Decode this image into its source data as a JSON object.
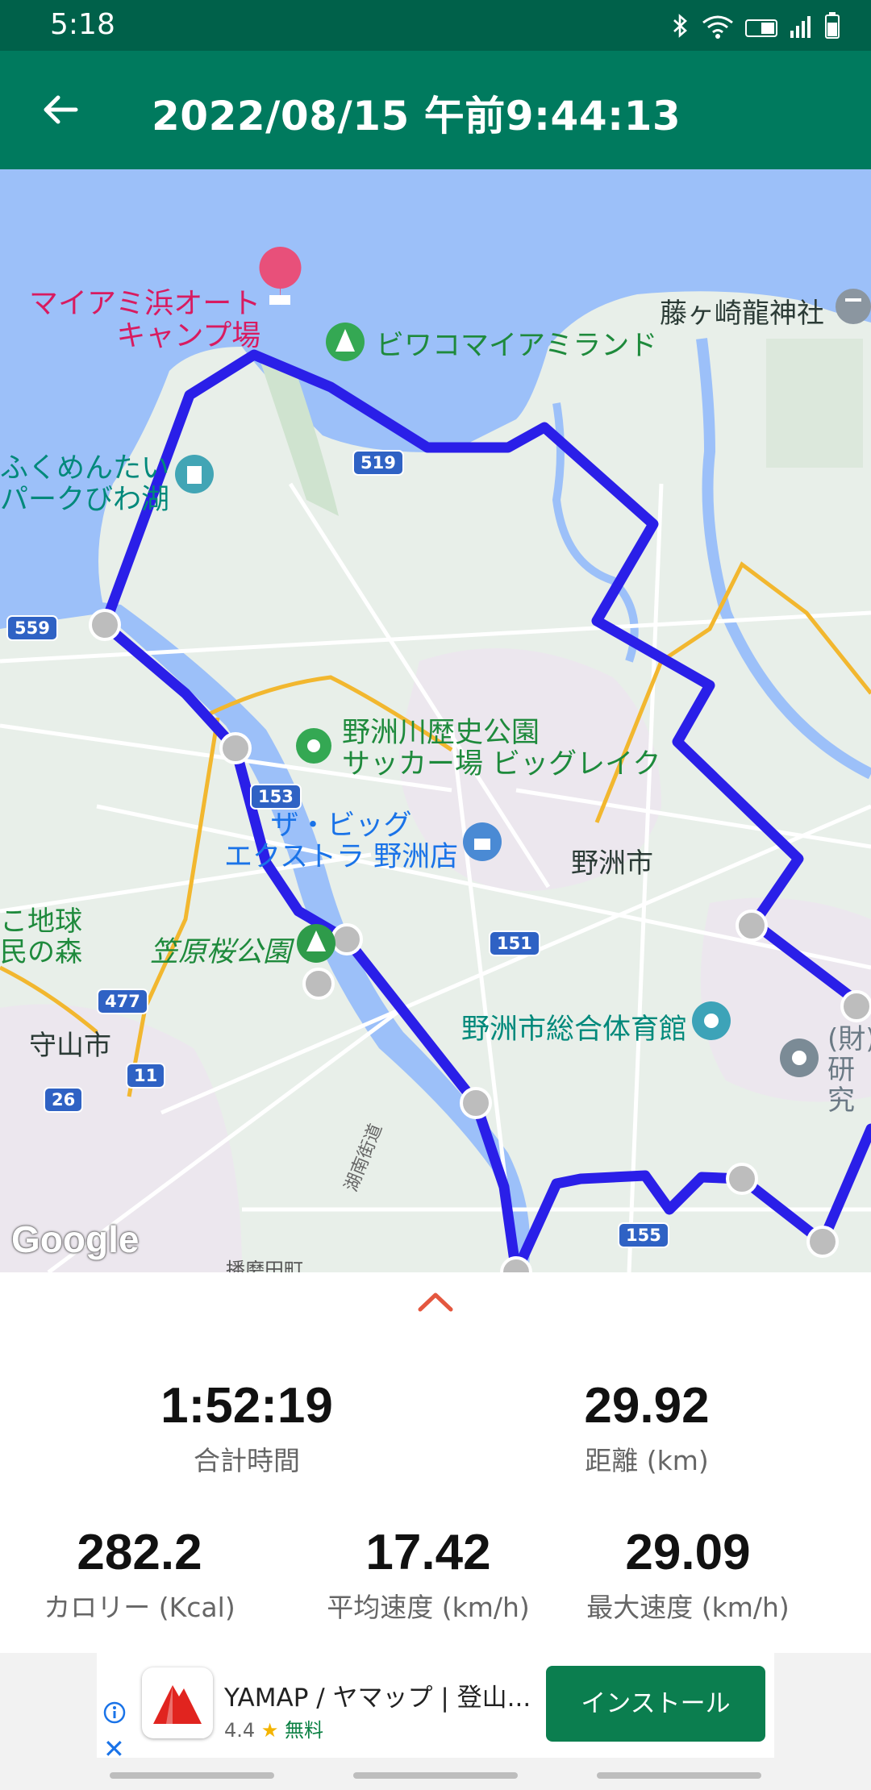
{
  "status_bar": {
    "time": "5:18",
    "icons": [
      "bluetooth-icon",
      "wifi-icon",
      "volte-icon",
      "signal-icon",
      "battery-icon"
    ]
  },
  "app_bar": {
    "title": "2022/08/15 午前9:44:13"
  },
  "map": {
    "labels": {
      "campground": "マイアミ浜オート\nキャンプ場",
      "biwako_miami": "ビワコマイアミランド",
      "fujigasaki": "藤ヶ崎龍神社",
      "fukumentai": "ふくめんたい\nパークびわ湖",
      "yasugawa_park": "野洲川歴史公園\nサッカー場 ビッグレイク",
      "the_big": "ザ・ビッグ\nエクストラ 野洲店",
      "yasu_city": "野洲市",
      "kasahara": "笠原桜公園",
      "moriyama": "守山市",
      "gym": "野洲市総合体育館",
      "kenkyu": "(財)\n研究",
      "chikyu": "こ地球\n民の森",
      "kaido": "湖南街道",
      "harima": "播磨田町"
    },
    "road_shields": [
      "519",
      "559",
      "153",
      "151",
      "477",
      "11",
      "26",
      "155"
    ],
    "attribution": "Google"
  },
  "stats": {
    "total_time": {
      "value": "1:52:19",
      "label": "合計時間"
    },
    "distance": {
      "value": "29.92",
      "label": "距離 (km)"
    },
    "calories": {
      "value": "282.2",
      "label": "カロリー (Kcal)"
    },
    "avg_speed": {
      "value": "17.42",
      "label": "平均速度 (km/h)"
    },
    "max_speed": {
      "value": "29.09",
      "label": "最大速度 (km/h)"
    }
  },
  "ad": {
    "title": "YAMAP / ヤマップ | 登山...",
    "rating": "4.4",
    "star": "★",
    "free": "無料",
    "install_label": "インストール",
    "close": "✕"
  },
  "colors": {
    "status_bar": "#00614a",
    "app_bar": "#007a5e",
    "route": "#2a1fe8",
    "water": "#9cc0f9",
    "install": "#0b7e4f"
  }
}
